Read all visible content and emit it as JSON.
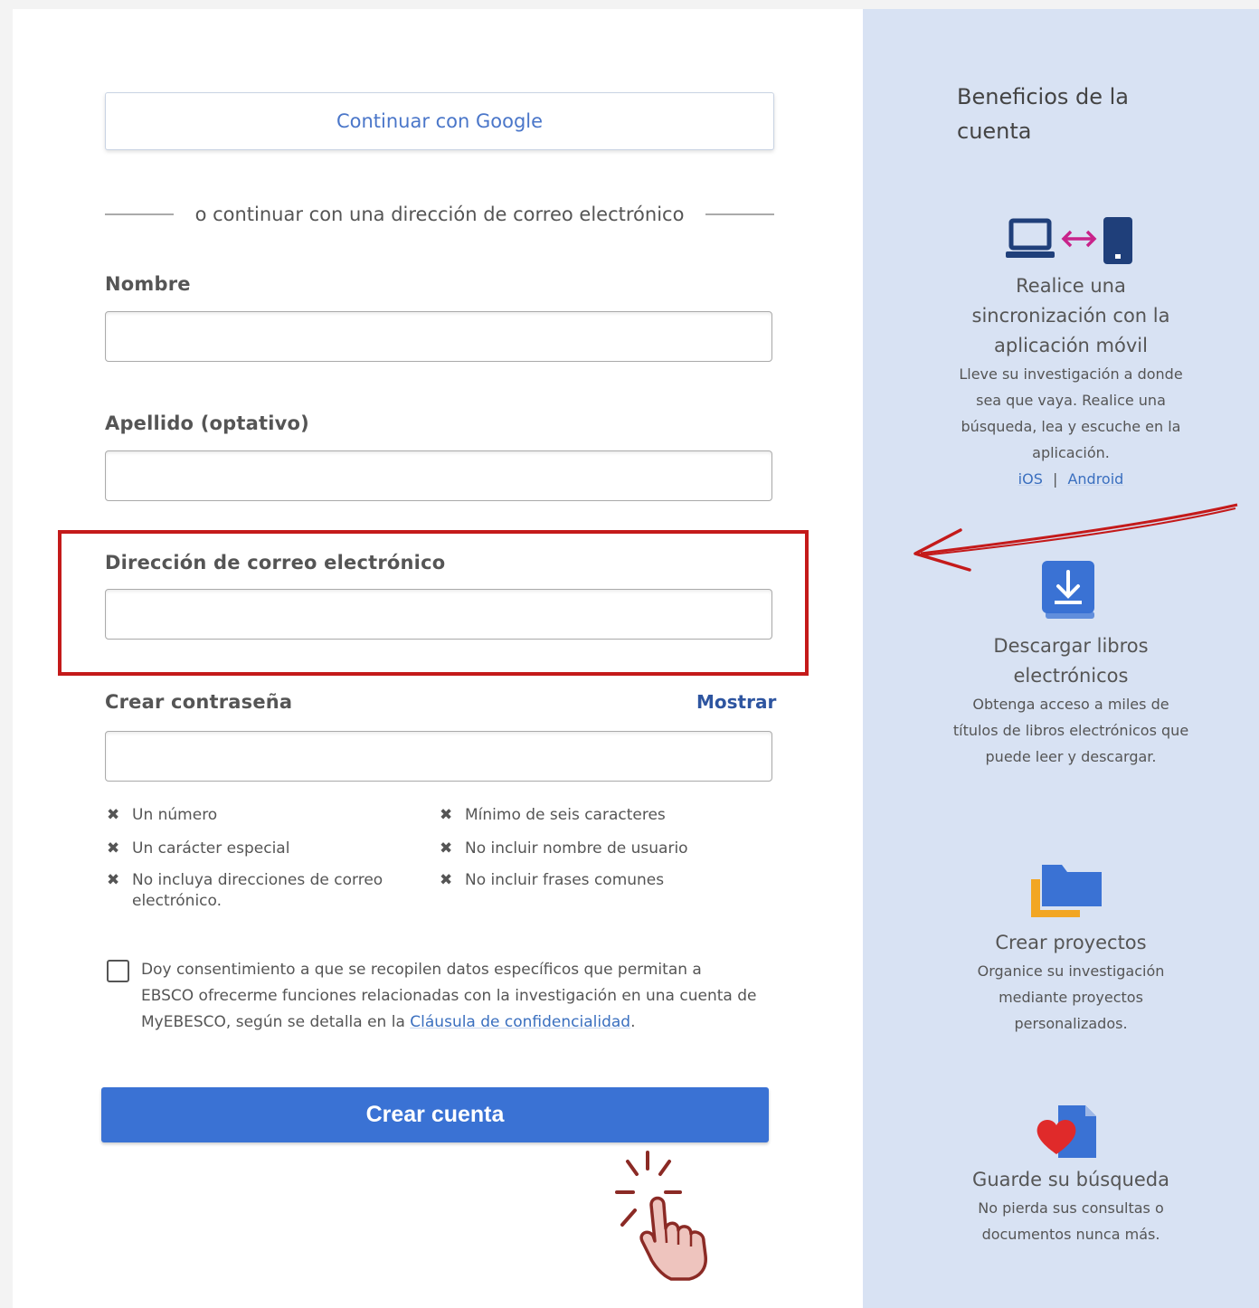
{
  "form": {
    "google_button": "Continuar con Google",
    "divider_text": "o continuar con una dirección de correo electrónico",
    "first_name_label": "Nombre",
    "last_name_label": "Apellido (optativo)",
    "email_label": "Dirección de correo electrónico",
    "password_label": "Crear contraseña",
    "show_password": "Mostrar",
    "password_rules": [
      "Un número",
      "Un carácter especial",
      "No incluya direcciones de correo electrónico.",
      "Mínimo de seis caracteres",
      "No incluir nombre de usuario",
      "No incluir frases comunes"
    ],
    "consent_text": "Doy consentimiento a que se recopilen datos específicos que permitan a EBSCO ofrecerme funciones relacionadas con la investigación en una cuenta de MyEBESCO, según se detalla en la ",
    "consent_link": "Cláusula de confidencialidad",
    "consent_end": ".",
    "create_button": "Crear cuenta"
  },
  "sidebar": {
    "title": "Beneficios de la cuenta",
    "benefits": [
      {
        "icon": "sync-devices-icon",
        "title": "Realice una sincronización con la aplicación móvil",
        "desc": "Lleve su investigación a donde sea que vaya. Realice una búsqueda, lea y escuche en la aplicación.",
        "link_ios": "iOS",
        "separator": "|",
        "link_android": "Android"
      },
      {
        "icon": "download-book-icon",
        "title": "Descargar libros electrónicos",
        "desc": "Obtenga acceso a miles de títulos de libros electrónicos que puede leer y descargar."
      },
      {
        "icon": "folder-icon",
        "title": "Crear proyectos",
        "desc": "Organice su investigación mediante proyectos personalizados."
      },
      {
        "icon": "heart-document-icon",
        "title": "Guarde su búsqueda",
        "desc": "No pierda sus consultas o documentos nunca más."
      }
    ]
  },
  "colors": {
    "primary_button": "#3a72d4",
    "sidebar_bg": "#d8e2f3",
    "annotation_red": "#c41a1a"
  }
}
